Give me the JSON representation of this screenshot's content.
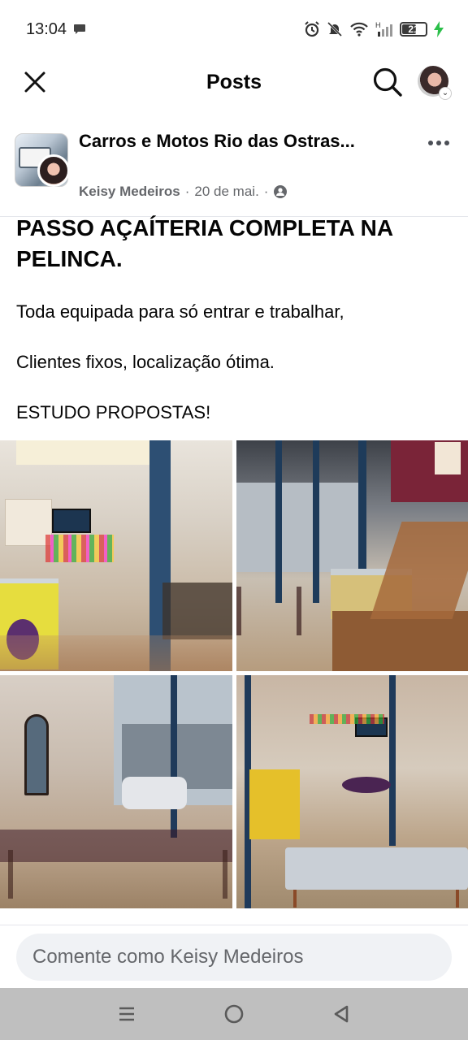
{
  "status_bar": {
    "time": "13:04",
    "battery": "21"
  },
  "header": {
    "title": "Posts"
  },
  "post": {
    "group_name": "Carros e Motos Rio das Ostras...",
    "author": "Keisy Medeiros",
    "date": "20 de mai.",
    "separator": "·",
    "headline": "PASSO AÇAÍTERIA COMPLETA NA PELINCA.",
    "paragraphs": [
      "Toda equipada para só entrar e trabalhar,",
      "Clientes fixos, localização ótima.",
      "ESTUDO PROPOSTAS!"
    ]
  },
  "comment": {
    "placeholder": "Comente como Keisy Medeiros"
  },
  "icons": {
    "close": "close-icon",
    "search": "search-icon",
    "more": "more-icon",
    "privacy": "group-privacy-icon",
    "nav_recent": "recent-apps-icon",
    "nav_home": "home-icon",
    "nav_back": "back-icon"
  },
  "colors": {
    "text": "#050505",
    "secondary": "#65676b",
    "input_bg": "#f0f2f5",
    "navbar": "#bfbfbf",
    "battery_charge": "#2bbf4a"
  }
}
